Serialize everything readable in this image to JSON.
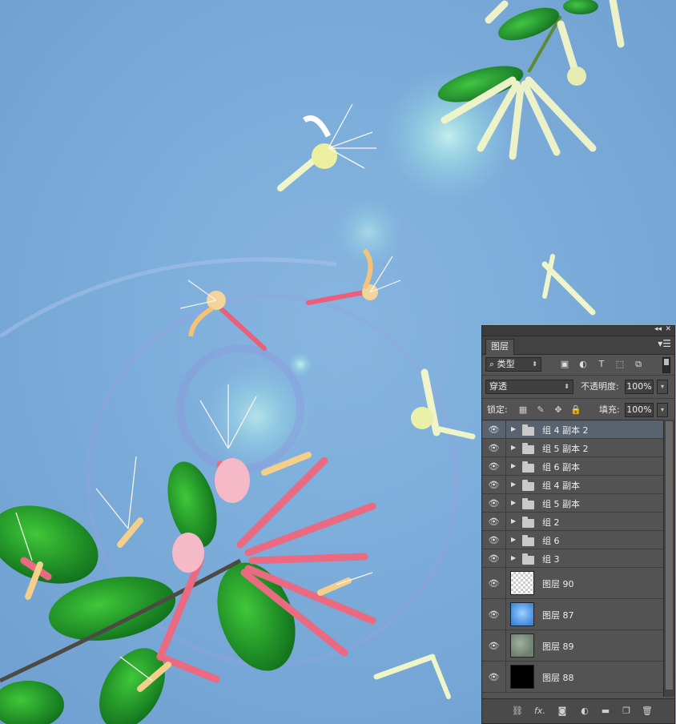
{
  "colors": {
    "canvas_bg": "#7aa8d6",
    "panel_bg": "#535353",
    "selected_row": "#59636f"
  },
  "panel": {
    "tab_label": "图层",
    "titlebar": {
      "collapse_icon": "double-chevron-icon",
      "close_icon": "close-icon"
    },
    "menu_icon": "panel-menu-icon",
    "filter": {
      "kind_label": "类型",
      "icons": [
        "image-filter-icon",
        "adjustment-filter-icon",
        "type-filter-icon",
        "shape-filter-icon",
        "smart-object-filter-icon"
      ]
    },
    "blend_mode": "穿透",
    "opacity_label": "不透明度:",
    "opacity_value": "100%",
    "lock_label": "锁定:",
    "lock_icons": [
      "lock-transparent-icon",
      "lock-brush-icon",
      "lock-move-icon",
      "lock-all-icon"
    ],
    "fill_label": "填充:",
    "fill_value": "100%",
    "layers": [
      {
        "name": "组 4 副本 2",
        "type": "group",
        "visible": true,
        "selected": true
      },
      {
        "name": "组 5 副本 2",
        "type": "group",
        "visible": true,
        "selected": false
      },
      {
        "name": "组 6 副本",
        "type": "group",
        "visible": true,
        "selected": false
      },
      {
        "name": "组 4 副本",
        "type": "group",
        "visible": true,
        "selected": false
      },
      {
        "name": "组 5 副本",
        "type": "group",
        "visible": true,
        "selected": false
      },
      {
        "name": "组 2",
        "type": "group",
        "visible": true,
        "selected": false
      },
      {
        "name": "组 6",
        "type": "group",
        "visible": true,
        "selected": false
      },
      {
        "name": "组 3",
        "type": "group",
        "visible": true,
        "selected": false
      },
      {
        "name": "图层 90",
        "type": "layer",
        "thumb": "transparent",
        "visible": true,
        "selected": false
      },
      {
        "name": "图层 87",
        "type": "layer",
        "thumb": "blue",
        "visible": true,
        "selected": false
      },
      {
        "name": "图层 89",
        "type": "layer",
        "thumb": "texture",
        "visible": true,
        "selected": false
      },
      {
        "name": "图层 88",
        "type": "layer",
        "thumb": "black",
        "visible": true,
        "selected": false
      }
    ],
    "bottom_icons": [
      "link-icon",
      "fx-icon",
      "mask-icon",
      "adjustment-icon",
      "folder-icon",
      "new-layer-icon",
      "trash-icon"
    ]
  }
}
